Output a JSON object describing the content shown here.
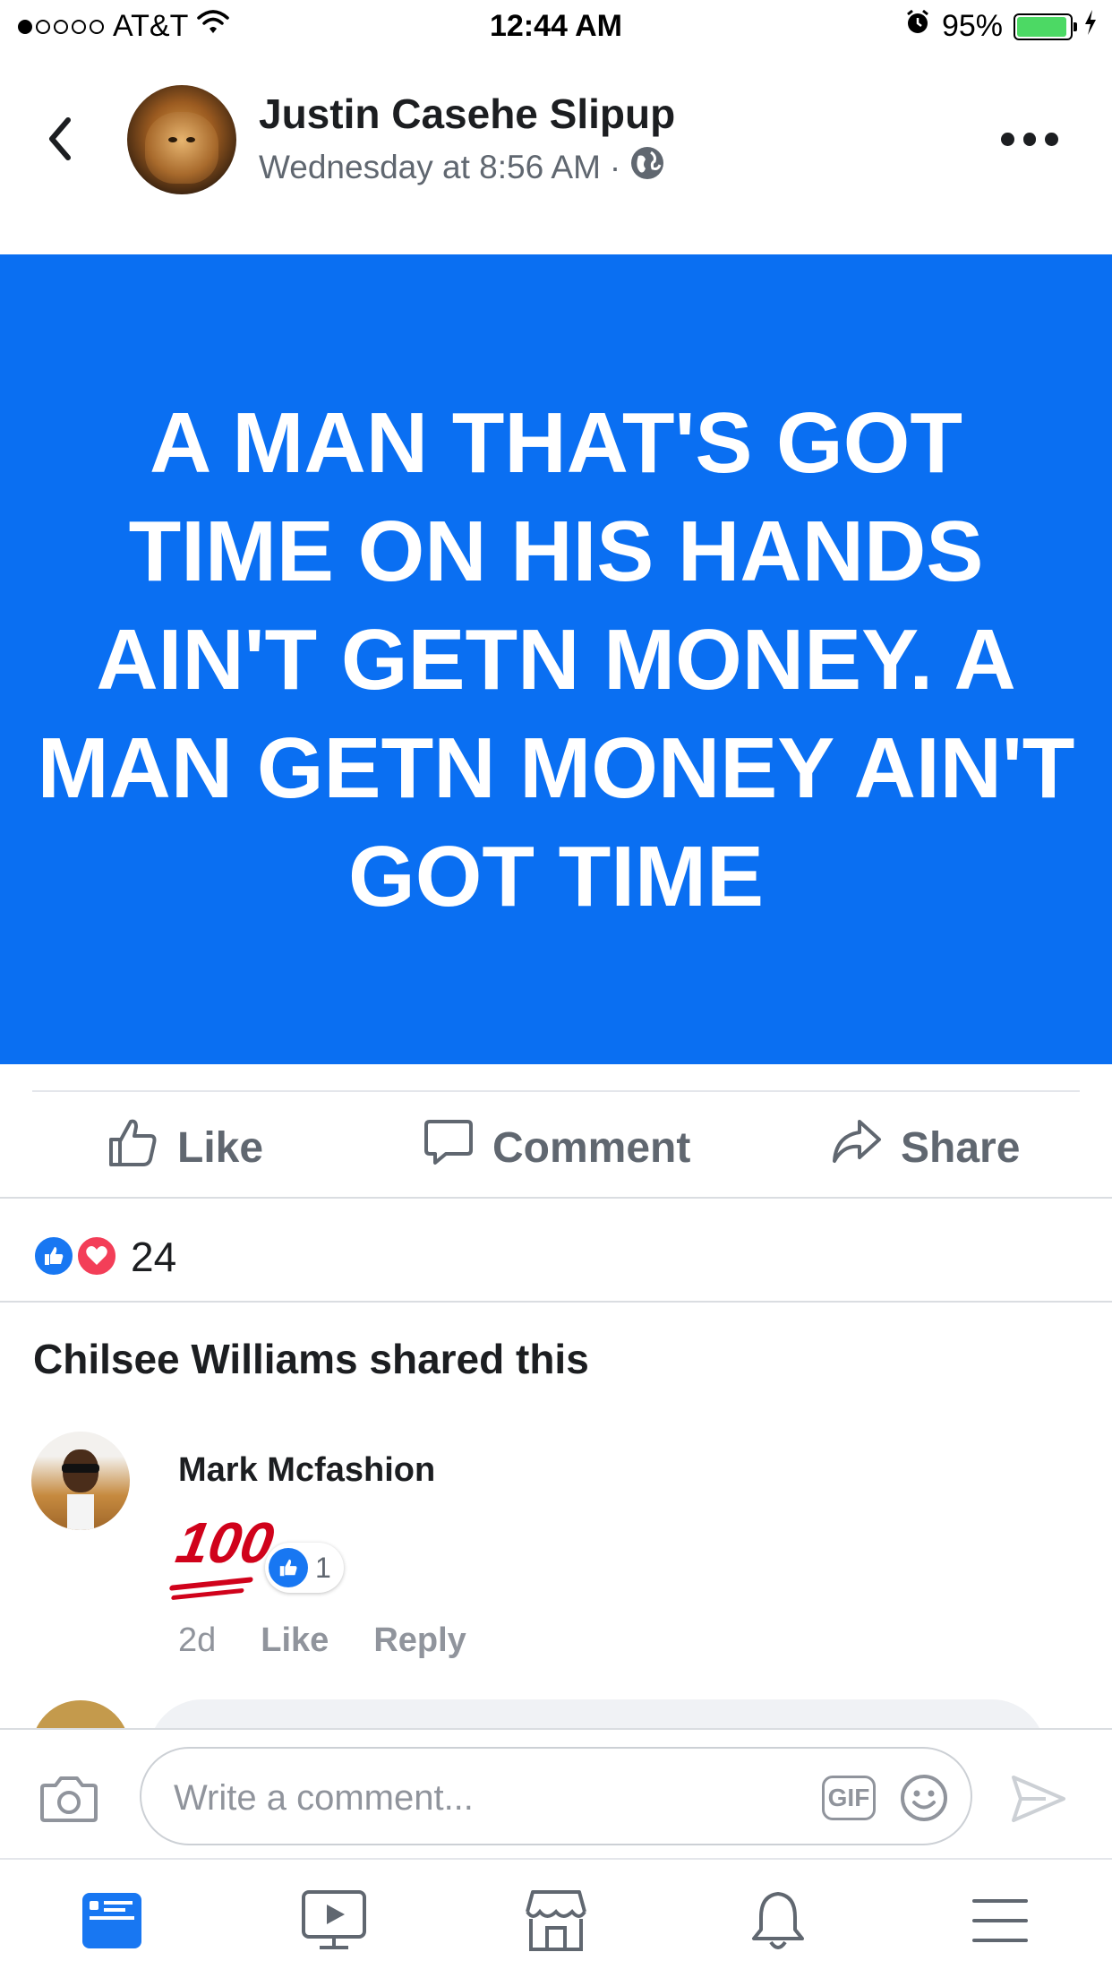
{
  "status_bar": {
    "carrier": "AT&T",
    "time": "12:44 AM",
    "battery": "95%",
    "battery_level": 0.95,
    "signal_bars": 1,
    "icons": [
      "wifi-icon",
      "alarm-icon",
      "charging-icon"
    ]
  },
  "post": {
    "author": "Justin Casehe Slipup",
    "timestamp": "Wednesday at 8:56 AM",
    "separator": "·",
    "privacy_icon": "globe-icon",
    "text": "A MAN THAT'S GOT TIME ON HIS HANDS AIN'T GETN MONEY. A MAN GETN MONEY AIN'T GOT TIME",
    "background_color": "#0a6ff2"
  },
  "actions": {
    "like": "Like",
    "comment": "Comment",
    "share": "Share"
  },
  "reactions": {
    "count": "24",
    "types": [
      "like",
      "love"
    ]
  },
  "shared_by": "Chilsee Williams shared this",
  "comments": [
    {
      "author": "Mark Mcfashion",
      "content_emoji": "100",
      "reaction_count": "1",
      "age": "2d",
      "like_label": "Like",
      "reply_label": "Reply"
    }
  ],
  "composer": {
    "placeholder": "Write a comment...",
    "gif_label": "GIF"
  },
  "tab_bar": {
    "tabs": [
      "news-feed",
      "watch",
      "marketplace",
      "notifications",
      "menu"
    ],
    "active": "news-feed",
    "active_color": "#1877f2"
  }
}
